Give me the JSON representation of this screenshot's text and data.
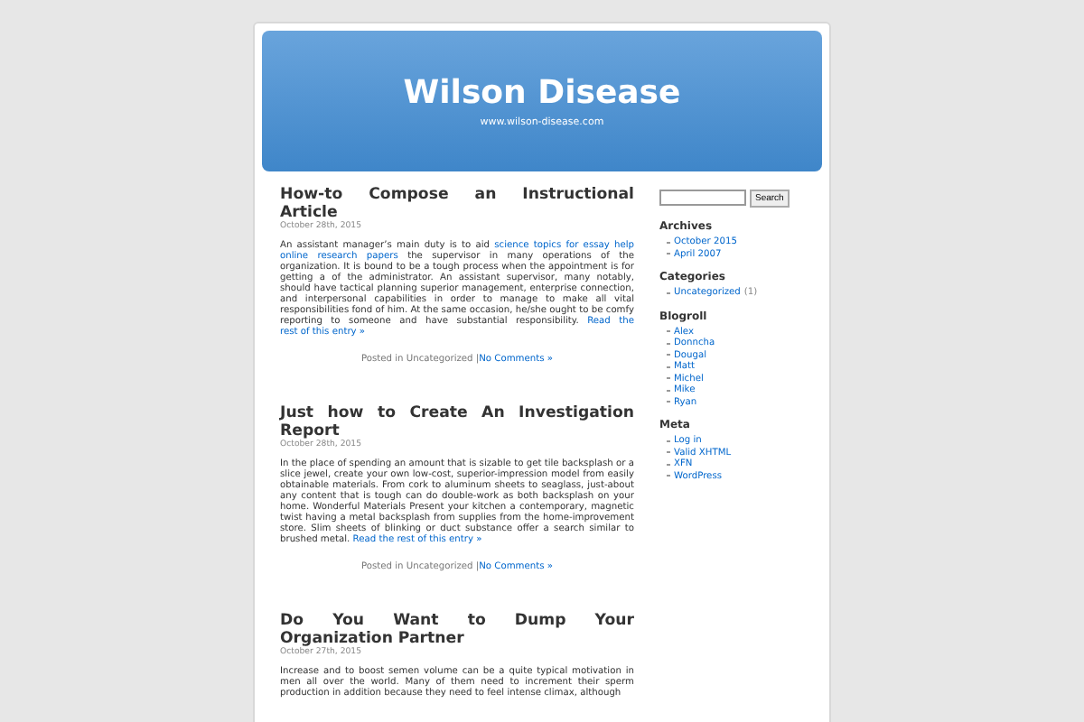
{
  "header": {
    "title": "Wilson Disease",
    "subtitle": "www.wilson-disease.com"
  },
  "posts": [
    {
      "title": "How-to Compose an Instructional Article",
      "date": "October 28th, 2015",
      "body": [
        {
          "kind": "text",
          "text": "An assistant manager’s main duty is to aid "
        },
        {
          "kind": "link",
          "text": "science topics for essay help"
        },
        {
          "kind": "link",
          "text": "online research papers"
        },
        {
          "kind": "text",
          "text": " the supervisor in many operations of the organization. It is bound to be a tough process when the appointment is for getting a of the administrator. An assistant supervisor, many notably, should have tactical planning superior management, enterprise connection, and interpersonal capabilities in order to manage to make all vital responsibilities fond of him. At the same occasion, he/she ought to be comfy reporting to someone and have substantial responsibility. "
        },
        {
          "kind": "link",
          "text": "Read the"
        },
        {
          "kind": "link",
          "text": "rest of this entry »"
        }
      ],
      "posted": "Posted in Uncategorized |",
      "comments": "No Comments »"
    },
    {
      "title": "Just how to Create An Investigation Report",
      "date": "October 28th, 2015",
      "body": [
        {
          "kind": "text",
          "text": "In the place of spending an amount that is sizable to get tile backsplash or a slice jewel, create your own low-cost, superior-impression model from easily obtainable materials. From cork to aluminum sheets to seaglass, just-about any content that is tough can do double-work as both backsplash on your home. Wonderful Materials Present your kitchen a contemporary, magnetic twist having a metal backsplash from supplies from the home-improvement store. Slim sheets of blinking or duct substance offer a search similar to brushed metal. "
        },
        {
          "kind": "link",
          "text": "Read the rest of this"
        },
        {
          "kind": "link",
          "text": "entry »"
        }
      ],
      "posted": "Posted in Uncategorized |",
      "comments": "No Comments »"
    },
    {
      "title": "Do You Want to Dump Your Organization Partner",
      "date": "October 27th, 2015",
      "body": [
        {
          "kind": "text",
          "text": "Increase and to boost semen volume can be a quite typical motivation in men all over the world. Many of them need to increment their sperm production in addition because they need to feel intense climax, although"
        }
      ]
    }
  ],
  "sidebar": {
    "search_button": "Search",
    "sections": [
      {
        "heading": "Archives",
        "items": [
          {
            "text": "October 2015"
          },
          {
            "text": "April 2007"
          }
        ]
      },
      {
        "heading": "Categories",
        "items": [
          {
            "text": "Uncategorized",
            "count": "(1)"
          }
        ]
      },
      {
        "heading": "Blogroll",
        "items": [
          {
            "text": "Alex"
          },
          {
            "text": "Donncha"
          },
          {
            "text": "Dougal"
          },
          {
            "text": "Matt"
          },
          {
            "text": "Michel"
          },
          {
            "text": "Mike"
          },
          {
            "text": "Ryan"
          }
        ]
      },
      {
        "heading": "Meta",
        "items": [
          {
            "text": "Log in"
          },
          {
            "text": "Valid XHTML"
          },
          {
            "text": "XFN"
          },
          {
            "text": "WordPress"
          }
        ]
      }
    ]
  }
}
